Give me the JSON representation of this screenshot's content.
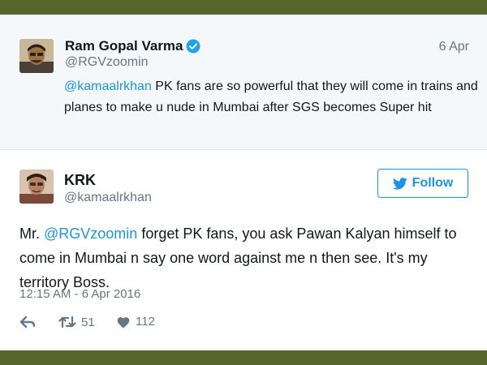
{
  "quoted_tweet": {
    "name": "Ram Gopal Varma",
    "handle": "@RGVzoomin",
    "date": "6 Apr",
    "mention": "@kamaalrkhan",
    "text_rest": " PK fans are so powerful that they will come in trains and planes to make u nude in Mumbai after SGS becomes Super hit",
    "verified_icon": "verified-badge-icon"
  },
  "main_tweet": {
    "name": "KRK",
    "handle": "@kamaalrkhan",
    "follow_label": "Follow",
    "text_prefix": "Mr. ",
    "mention": "@RGVzoomin",
    "text_rest": " forget PK fans, you ask Pawan Kalyan himself to come in Mumbai n say one word against me n then see. It's my territory Boss.",
    "timestamp": "12:15 AM - 6 Apr 2016",
    "retweet_count": "51",
    "like_count": "112"
  },
  "colors": {
    "accent": "#1b95e0",
    "frame_bg": "#57672c",
    "quoted_bg": "#f4f8fb",
    "muted": "#657786"
  }
}
